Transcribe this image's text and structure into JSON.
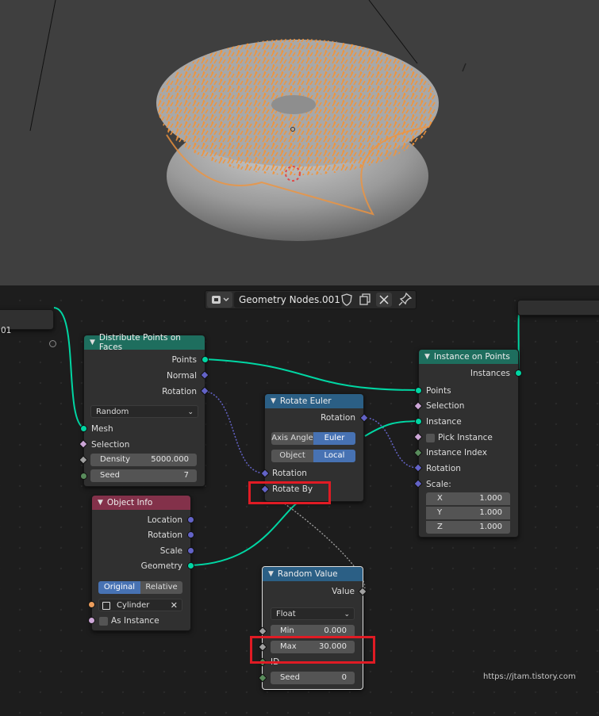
{
  "header": {
    "node_tree_name": "Geometry Nodes.001",
    "editor_icon": "node-tree-icon",
    "shield_icon": "fake-user-shield-icon",
    "copy_icon": "duplicate-icon",
    "close_icon": "close-icon",
    "pin_icon": "pin-icon"
  },
  "left_stub": {
    "label": "01"
  },
  "distribute": {
    "title": "Distribute Points on Faces",
    "out_points": "Points",
    "out_normal": "Normal",
    "out_rotation": "Rotation",
    "method": "Random",
    "in_mesh": "Mesh",
    "in_selection": "Selection",
    "density_label": "Density",
    "density_value": "5000.000",
    "seed_label": "Seed",
    "seed_value": "7"
  },
  "rotate_euler": {
    "title": "Rotate Euler",
    "out_rotation": "Rotation",
    "mode_a": "Axis Angle",
    "mode_b": "Euler",
    "space_a": "Object",
    "space_b": "Local",
    "in_rotation": "Rotation",
    "in_rotate_by": "Rotate By"
  },
  "instance_on_points": {
    "title": "Instance on Points",
    "out_instances": "Instances",
    "in_points": "Points",
    "in_selection": "Selection",
    "in_instance": "Instance",
    "pick_instance": "Pick Instance",
    "instance_index": "Instance Index",
    "in_rotation": "Rotation",
    "scale_label": "Scale:",
    "scale_x_label": "X",
    "scale_x": "1.000",
    "scale_y_label": "Y",
    "scale_y": "1.000",
    "scale_z_label": "Z",
    "scale_z": "1.000"
  },
  "object_info": {
    "title": "Object Info",
    "out_location": "Location",
    "out_rotation": "Rotation",
    "out_scale": "Scale",
    "out_geometry": "Geometry",
    "mode_a": "Original",
    "mode_b": "Relative",
    "object_name": "Cylinder",
    "as_instance": "As Instance"
  },
  "random_value": {
    "title": "Random Value",
    "out_value": "Value",
    "type": "Float",
    "min_label": "Min",
    "min_value": "0.000",
    "max_label": "Max",
    "max_value": "30.000",
    "id_label": "ID",
    "seed_label": "Seed",
    "seed_value": "0"
  },
  "watermark": "https://jtam.tistory.com",
  "colors": {
    "geometry_socket": "#00d6a3",
    "vector_socket": "#6363c7",
    "bool_socket": "#cca6d6",
    "float_socket": "#a1a1a1",
    "int_socket": "#598c5c",
    "object_socket": "#ed9e5c",
    "distribute_header": "#1e6e5e",
    "rotate_header": "#2b5f85",
    "object_info_header": "#83314a",
    "selection_orange": "#f0943c",
    "highlight_red": "#e01b24"
  }
}
